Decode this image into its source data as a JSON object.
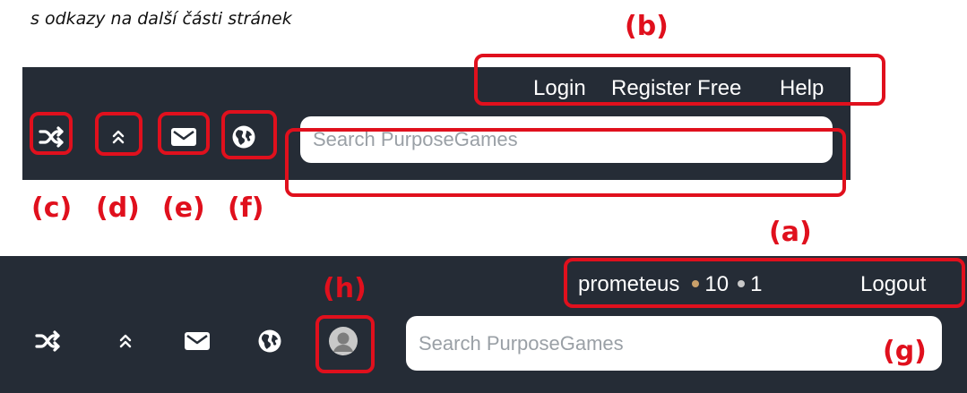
{
  "caption": "s odkazy na další části stránek",
  "top_bar": {
    "links": {
      "login": "Login",
      "register": "Register Free",
      "help": "Help"
    },
    "search_placeholder": "Search PurposeGames"
  },
  "bottom_bar": {
    "user": {
      "name": "prometeus",
      "points": "10",
      "badges": "1",
      "logout": "Logout"
    },
    "search_placeholder": "Search PurposeGames"
  },
  "icons": [
    "shuffle-icon",
    "chevrons-up-icon",
    "mail-icon",
    "globe-icon",
    "avatar-icon"
  ],
  "annotations": {
    "a": "(a)",
    "b": "(b)",
    "c": "(c)",
    "d": "(d)",
    "e": "(e)",
    "f": "(f)",
    "g": "(g)",
    "h": "(h)"
  },
  "colors": {
    "bar": "#252c36",
    "highlight": "#e0101d",
    "points_dot": "#c9a06a",
    "badge_dot": "#c8c8c8"
  }
}
